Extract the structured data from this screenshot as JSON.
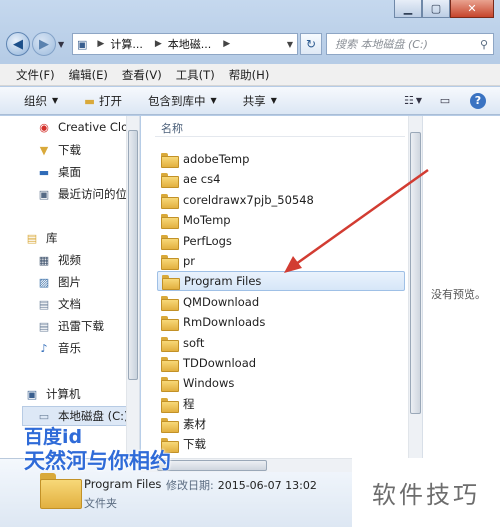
{
  "address": {
    "segments": [
      "计算...",
      "本地磁..."
    ],
    "search_placeholder": "搜索 本地磁盘 (C:)"
  },
  "menu": [
    "文件(F)",
    "编辑(E)",
    "查看(V)",
    "工具(T)",
    "帮助(H)"
  ],
  "toolbar": {
    "organize": "组织",
    "open": "打开",
    "include_library": "包含到库中",
    "share": "共享"
  },
  "nav": {
    "creative_cloud": "Creative Clo",
    "downloads": "下载",
    "desktop": "桌面",
    "recent": "最近访问的位",
    "library": "库",
    "video": "视频",
    "pictures": "图片",
    "documents": "文档",
    "xunlei": "迅雷下载",
    "music": "音乐",
    "computer": "计算机",
    "local_disk": "本地磁盘 (C:)"
  },
  "files": {
    "column_name": "名称",
    "items": [
      "adobeTemp",
      "ae cs4",
      "coreldrawx7pjb_50548",
      "MoTemp",
      "PerfLogs",
      "pr",
      "Program Files",
      "QMDownload",
      "RmDownloads",
      "soft",
      "TDDownload",
      "Windows",
      "程",
      "素材",
      "下载"
    ]
  },
  "preview": {
    "message": "没有预览。"
  },
  "details": {
    "name": "Program Files",
    "modified_label": "修改日期:",
    "modified_value": "2015-06-07 13:02",
    "type": "文件夹"
  },
  "watermark": {
    "line1": "百度id",
    "line2": "天然河与你相约",
    "right": "软件技巧"
  }
}
